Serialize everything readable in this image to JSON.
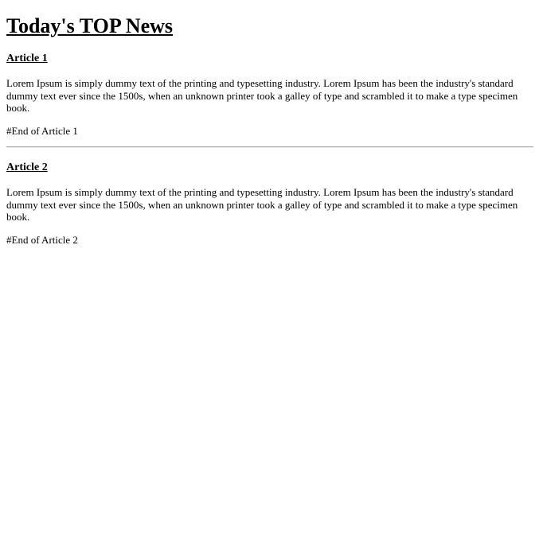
{
  "page": {
    "title": "Today's TOP News"
  },
  "articles": [
    {
      "title": "Article 1",
      "body": "Lorem Ipsum is simply dummy text of the printing and typesetting industry. Lorem Ipsum has been the industry's standard dummy text ever since the 1500s, when an unknown printer took a galley of type and scrambled it to make a type specimen book.",
      "end": "#End of Article 1"
    },
    {
      "title": "Article 2",
      "body": "Lorem Ipsum is simply dummy text of the printing and typesetting industry. Lorem Ipsum has been the industry's standard dummy text ever since the 1500s, when an unknown printer took a galley of type and scrambled it to make a type specimen book.",
      "end": "#End of Article 2"
    }
  ]
}
